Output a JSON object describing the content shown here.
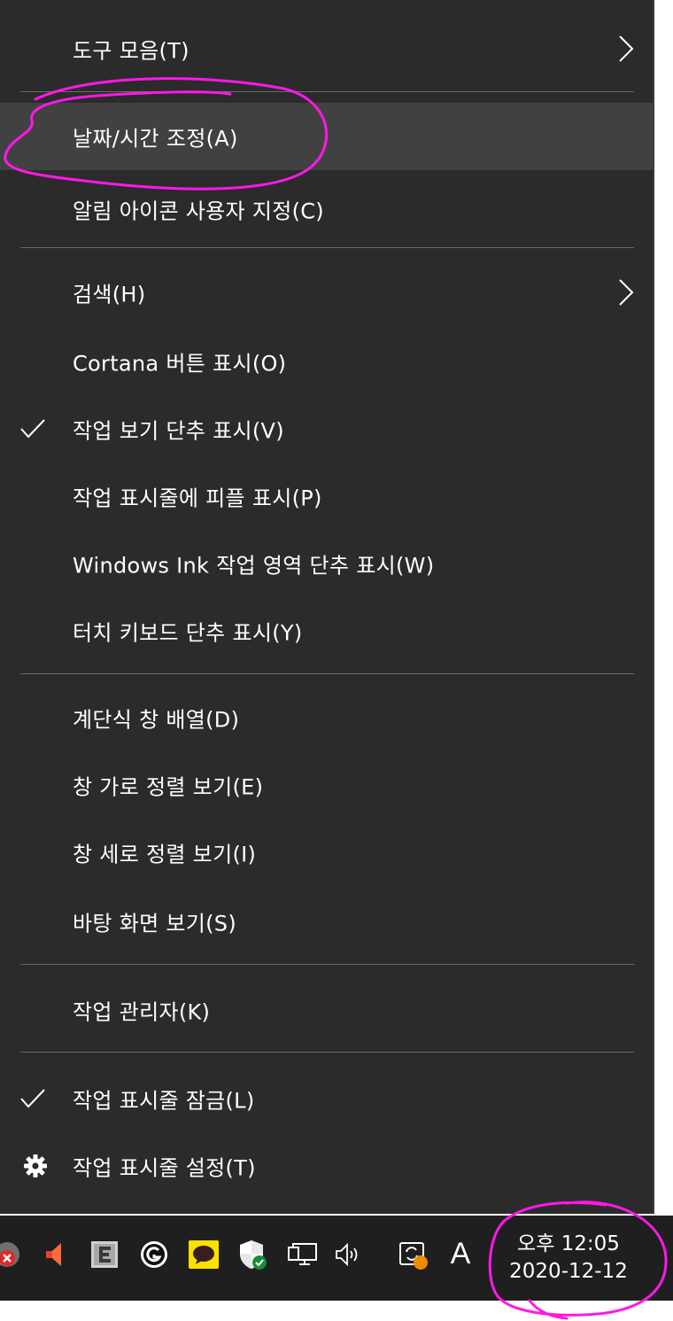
{
  "context_menu": {
    "items": [
      {
        "label": "도구 모음(T)",
        "has_submenu": true
      },
      {
        "label": "날짜/시간 조정(A)",
        "highlighted": true
      },
      {
        "label": "알림 아이콘 사용자 지정(C)"
      },
      {
        "label": "검색(H)",
        "has_submenu": true
      },
      {
        "label": "Cortana 버튼 표시(O)"
      },
      {
        "label": "작업 보기 단추 표시(V)",
        "checked": true
      },
      {
        "label": "작업 표시줄에 피플 표시(P)"
      },
      {
        "label": "Windows Ink 작업 영역 단추 표시(W)"
      },
      {
        "label": "터치 키보드 단추 표시(Y)"
      },
      {
        "label": "계단식 창 배열(D)"
      },
      {
        "label": "창 가로 정렬 보기(E)"
      },
      {
        "label": "창 세로 정렬 보기(I)"
      },
      {
        "label": "바탕 화면 보기(S)"
      },
      {
        "label": "작업 관리자(K)"
      },
      {
        "label": "작업 표시줄 잠금(L)",
        "checked": true
      },
      {
        "label": "작업 표시줄 설정(T)",
        "icon": "gear-icon"
      }
    ]
  },
  "taskbar": {
    "tray_icons": [
      "error-badge-icon",
      "speaker-muted-icon",
      "e-app-icon",
      "g-app-icon",
      "kakaotalk-icon",
      "security-shield-icon",
      "network-icon",
      "volume-icon",
      "sync-app-icon"
    ],
    "input_language": "A",
    "clock": {
      "time": "오후 12:05",
      "date": "2020-12-12"
    }
  },
  "colors": {
    "menu_background": "#2b2b2b",
    "menu_highlight": "#414141",
    "separator": "#6a6a6a",
    "taskbar_background": "#1f1f1f",
    "annotation_ink": "#ff18e8"
  }
}
